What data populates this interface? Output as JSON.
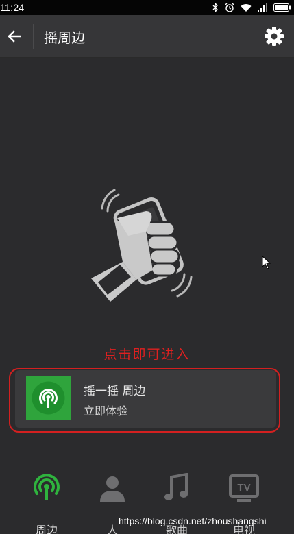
{
  "status_bar": {
    "time": "11:24"
  },
  "nav": {
    "title": "摇周边"
  },
  "hint": {
    "text": "点击即可进入"
  },
  "entry": {
    "title": "摇一摇 周边",
    "subtitle": "立即体验"
  },
  "tabs": [
    {
      "label": "周边",
      "icon": "radar-icon",
      "active": true
    },
    {
      "label": "人",
      "icon": "person-icon",
      "active": false
    },
    {
      "label": "歌曲",
      "icon": "music-note-icon",
      "active": false
    },
    {
      "label": "电视",
      "icon": "tv-icon",
      "active": false
    }
  ],
  "watermark": {
    "text": "https://blog.csdn.net/zhoushangshi"
  },
  "colors": {
    "accent_green": "#2fa43c",
    "hint_red": "#e02020",
    "background": "#2b2b2d",
    "nav_background": "#363638"
  }
}
